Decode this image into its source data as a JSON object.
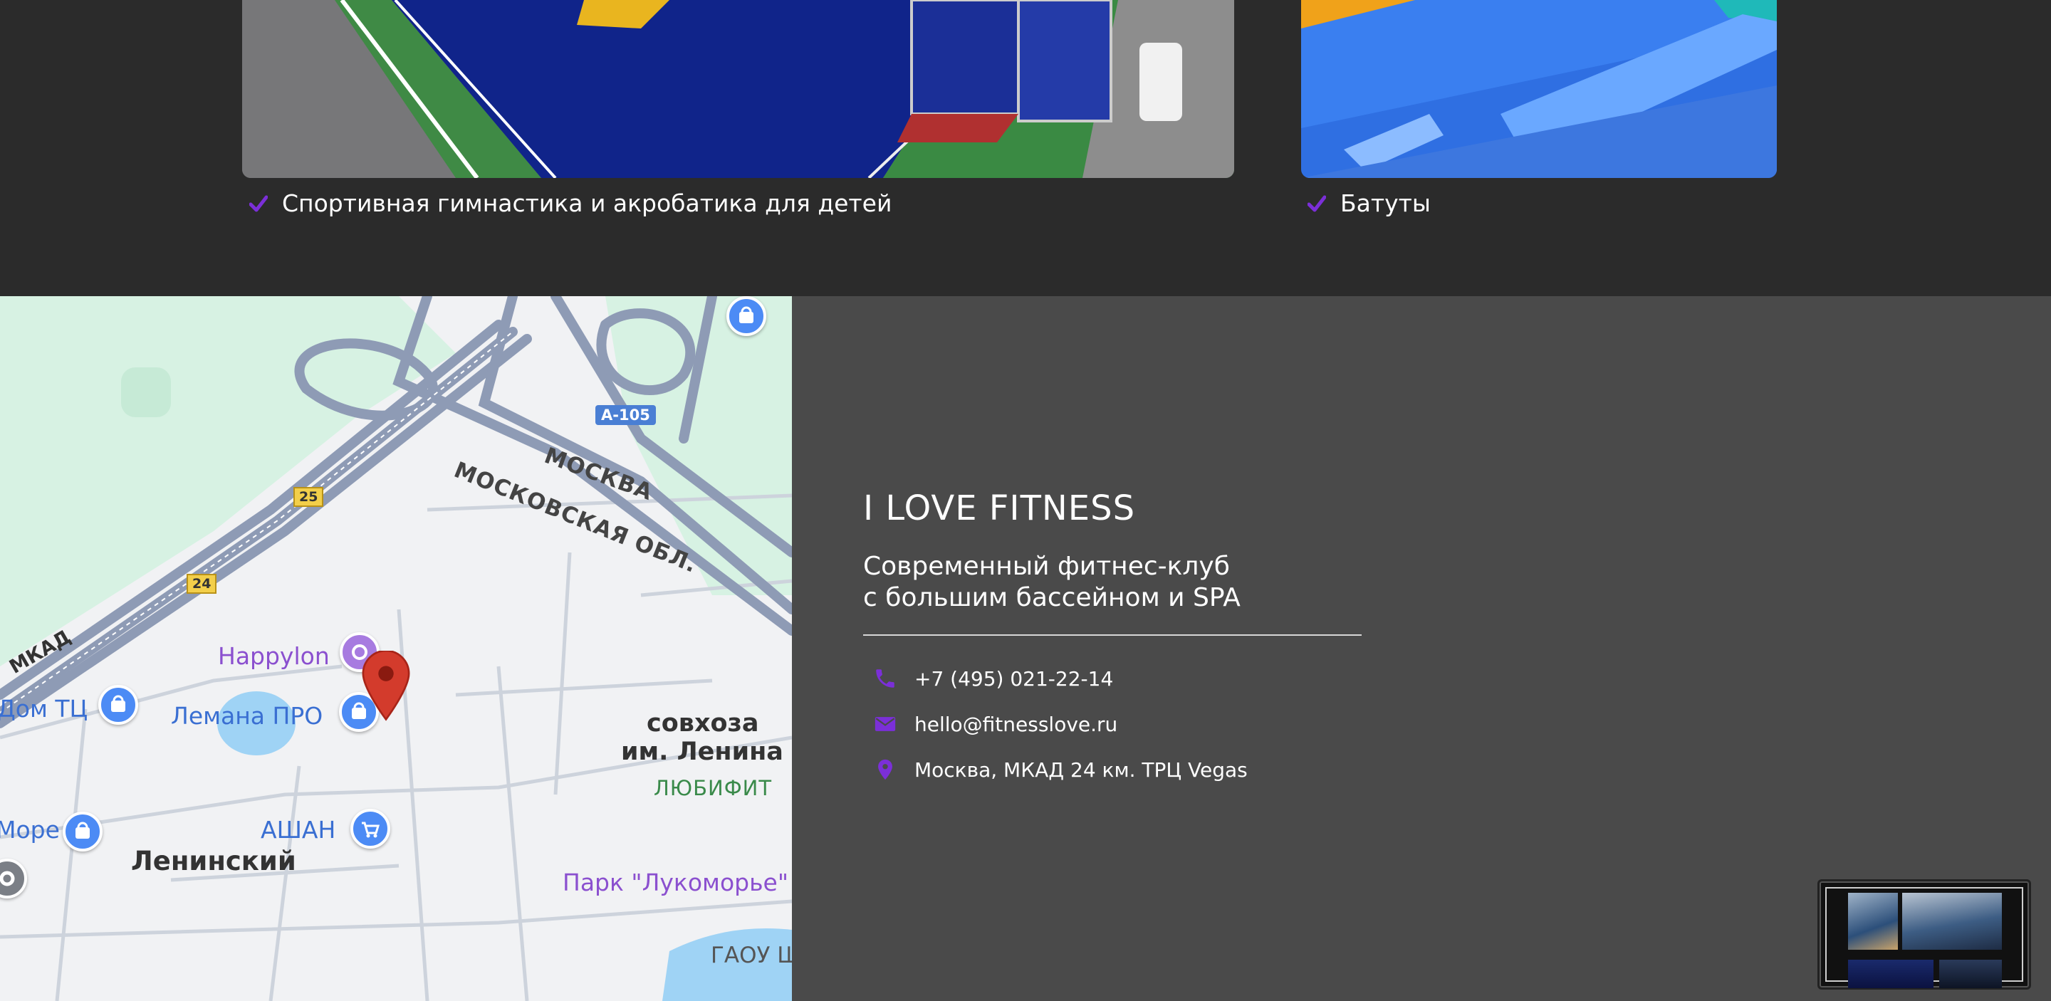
{
  "programs": [
    {
      "title": "Спортивная гимнастика и акробатика для детей",
      "icon": "check-icon"
    },
    {
      "title": "Батуты",
      "icon": "check-icon"
    }
  ],
  "map": {
    "labels": {
      "road_a105": "A-105",
      "moskva": "МОСКВА",
      "moskovskaya_obl": "МОСКОВСКАЯ ОБЛ.",
      "km25": "25",
      "km24": "24",
      "mkad": "МКАД",
      "happylon": "Happylon",
      "dom_tc": "Дом ТЦ",
      "lemana": "Лемана ПРО",
      "sovkhoz_1": "совхоза",
      "sovkhoz_2": "им. Ленина",
      "lyubifit": "ЛЮБИФИТ",
      "more": "Море",
      "ashan": "АШАН",
      "leninsky": "Ленинский",
      "park": "Парк \"Лукоморье\"",
      "gaou": "ГАОУ Ш"
    }
  },
  "contacts": {
    "brand": "I LOVE FITNESS",
    "tagline_line1": "Современный фитнес-клуб",
    "tagline_line2": "с большим бассейном и SPA",
    "phone": "+7 (495) 021-22-14",
    "email": "hello@fitnesslove.ru",
    "address": "Москва, МКАД 24 км. ТРЦ Vegas"
  },
  "colors": {
    "accent": "#7b2fd8",
    "dark_bg": "#2b2b2b",
    "contacts_bg": "#4a4a4a",
    "map_pin": "#d33b2c"
  }
}
